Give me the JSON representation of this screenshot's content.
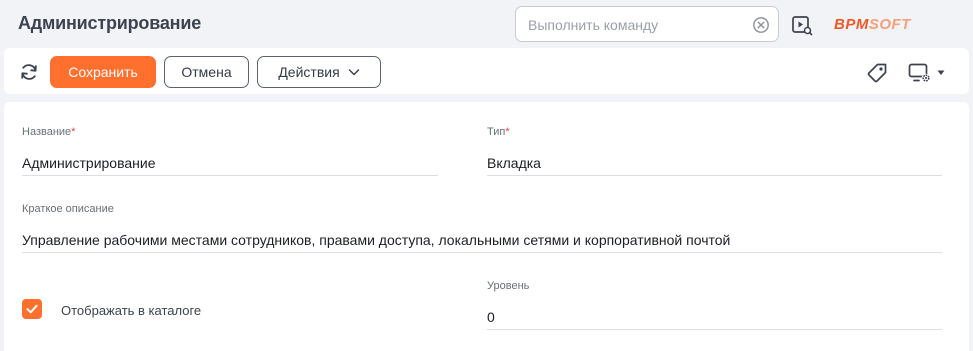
{
  "header": {
    "title": "Администрирование",
    "command": {
      "placeholder": "Выполнить команду",
      "value": ""
    },
    "logo": {
      "part1": "BPM",
      "part2": "SOFT"
    }
  },
  "toolbar": {
    "save_label": "Сохранить",
    "cancel_label": "Отмена",
    "actions_label": "Действия"
  },
  "form": {
    "name": {
      "label": "Название",
      "required_mark": "*",
      "value": "Администрирование"
    },
    "type": {
      "label": "Тип",
      "required_mark": "*",
      "value": "Вкладка"
    },
    "description": {
      "label": "Краткое описание",
      "value": "Управление рабочими местами сотрудников, правами доступа, локальными сетями и корпоративной почтой"
    },
    "show_in_catalog": {
      "label": "Отображать в каталоге",
      "checked": true
    },
    "level": {
      "label": "Уровень",
      "value": "0"
    }
  },
  "colors": {
    "accent": "#ff6f2e",
    "required": "#e24a3b",
    "background": "#f1f3f6"
  },
  "icons": [
    "refresh-icon",
    "clear-icon",
    "video-icon",
    "chevron-down-icon",
    "tag-icon",
    "display-settings-icon",
    "check-icon"
  ]
}
